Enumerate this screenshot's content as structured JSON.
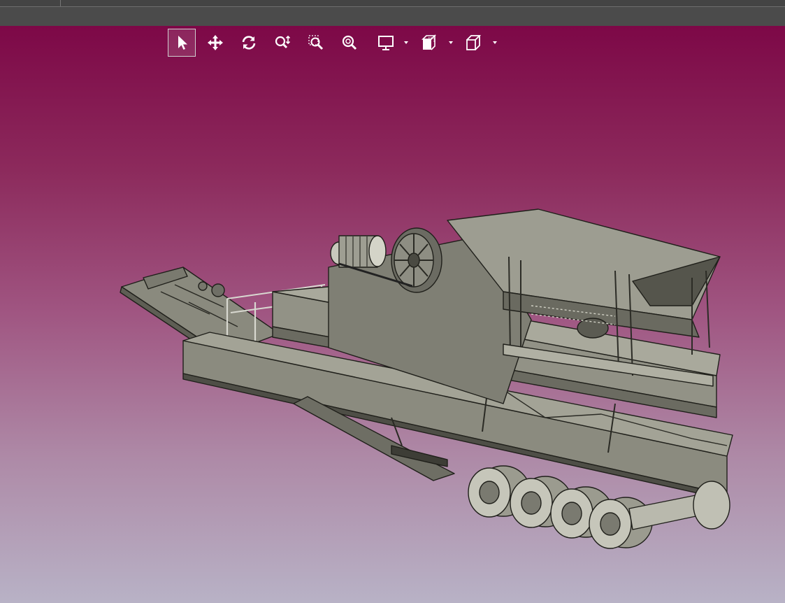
{
  "window": {
    "top_bar": {
      "tabs": []
    }
  },
  "viewport": {
    "background_top": "#7d0847",
    "background_bottom": "#b8b2c6",
    "toolbar": {
      "tools": [
        {
          "id": "select",
          "icon": "pointer-arrow-icon",
          "active": true
        },
        {
          "id": "pan",
          "icon": "move-arrows-icon",
          "active": false
        },
        {
          "id": "rotate",
          "icon": "rotate-icon",
          "active": false
        },
        {
          "id": "zoom-dynamic",
          "icon": "zoom-dynamic-icon",
          "active": false
        },
        {
          "id": "zoom-window",
          "icon": "zoom-window-icon",
          "active": false
        },
        {
          "id": "zoom-fit",
          "icon": "zoom-fit-icon",
          "active": false
        },
        {
          "id": "display-mode",
          "icon": "monitor-icon",
          "has_dropdown": true
        },
        {
          "id": "view-orientation",
          "icon": "view-cube-icon",
          "has_dropdown": true
        },
        {
          "id": "render-style",
          "icon": "box-icon",
          "has_dropdown": true
        }
      ]
    },
    "model": {
      "name_icon": "mobile-crusher-trailer-3d-model",
      "surface_color": "#8c8c80",
      "edge_color": "#1f1f1a"
    }
  }
}
